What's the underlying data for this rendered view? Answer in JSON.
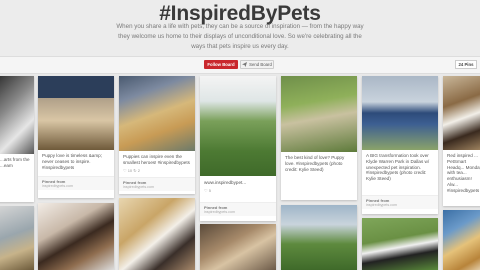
{
  "header": {
    "title": "#InspiredByPets",
    "description": "When you share a life with pets, they can be a source of inspiration — from the happy way they welcome us home to their displays of unconditional love. So we're celebrating all the ways that pets inspire us every day."
  },
  "toolbar": {
    "follow_label": "Follow Board",
    "send_label": "Send Board",
    "send_icon": "paper-plane-icon",
    "pins_label": "24 Pins"
  },
  "pins": [
    {
      "caption": "...arts from the ...eam",
      "stats": "",
      "source_label": "",
      "source_url": ""
    },
    {
      "caption": "Puppy love is timeless &amp; never ceases to inspire. #inspiredbypets",
      "stats": "",
      "source_label": "Pinned from",
      "source_url": "inspiredbypets.com"
    },
    {
      "caption": "Puppies can inspire even the smallest heroes! #inspiredbypets",
      "stats": "♡ 10  ↻ 2",
      "source_label": "Pinned from",
      "source_url": "inspiredbypets.com"
    },
    {
      "caption": "www.inspiredbypet... ",
      "stats": "♡ 5",
      "source_label": "Pinned from",
      "source_url": "inspiredbypets.com"
    },
    {
      "caption": "The best kind of love? Puppy love. #inspiredbypets (photo credit: Kylie Steed)",
      "stats": "",
      "source_label": "",
      "source_url": ""
    },
    {
      "caption": "A BIG transformation took over Klyde Warren Park in Dallas w/ unexpected pet inspiration. #inspiredbypets (photo credit: Kylie Steed)",
      "stats": "",
      "source_label": "Pinned from",
      "source_url": "inspiredbypets.com"
    },
    {
      "caption": "Red inspired ... PetSmart Headq... Monday with tea... enthusiasm! Alw... #inspiredbypets",
      "stats": "",
      "source_label": "",
      "source_url": ""
    }
  ],
  "colors": {
    "accent": "#c9272d",
    "background": "#e9e9e9"
  }
}
